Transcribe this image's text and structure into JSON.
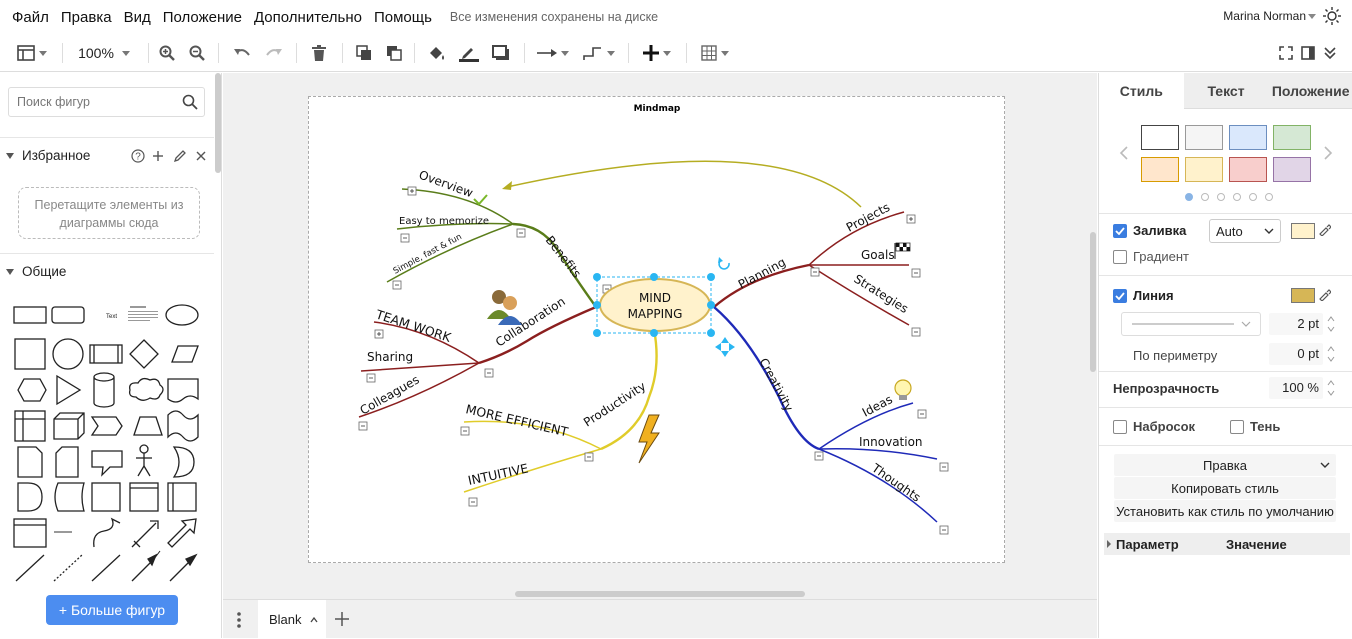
{
  "menu": {
    "items": [
      "Файл",
      "Правка",
      "Вид",
      "Положение",
      "Дополнительно",
      "Помощь"
    ],
    "status": "Все изменения сохранены на диске",
    "user": "Marina Norman"
  },
  "toolbar": {
    "zoom": "100%"
  },
  "left": {
    "search_placeholder": "Поиск фигур",
    "favorites_title": "Избранное",
    "dropzone_text": "Перетащите элементы из диаграммы сюда",
    "general_title": "Общие",
    "more_shapes": "+ Больше фигур"
  },
  "diagram": {
    "title": "Mindmap",
    "center_line1": "MIND",
    "center_line2": "MAPPING",
    "branches": {
      "benefits": "Benefits",
      "overview": "Overview",
      "easy": "Easy to memorize",
      "simple": "Simple, fast & fun",
      "collaboration": "Collaboration",
      "teamwork": "TEAM WORK",
      "sharing": "Sharing",
      "colleagues": "Colleagues",
      "productivity": "Productivity",
      "efficient": "MORE EFFICIENT",
      "intuitive": "INTUITIVE",
      "planning": "Planning",
      "projects": "Projects",
      "goals": "Goals",
      "strategies": "Strategies",
      "creativity": "Creativity",
      "ideas": "Ideas",
      "innovation": "Innovation",
      "thoughts": "Thoughts"
    }
  },
  "bottom": {
    "page_tab": "Blank"
  },
  "right": {
    "tabs": [
      "Стиль",
      "Текст",
      "Положение"
    ],
    "swatches": [
      "#ffffff",
      "#f5f5f5",
      "#dae8fc",
      "#d5e8d4",
      "#ffe6cc",
      "#fff2cc",
      "#f8cecc",
      "#e1d5e7"
    ],
    "fill_label": "Заливка",
    "fill_value": "Auto",
    "fill_color": "#fff2cc",
    "gradient_label": "Градиент",
    "line_label": "Линия",
    "line_color": "#d6b656",
    "line_width": "2 pt",
    "perimeter_label": "По периметру",
    "perimeter_value": "0 pt",
    "opacity_label": "Непрозрачность",
    "opacity_value": "100 %",
    "sketch_label": "Набросок",
    "shadow_label": "Тень",
    "edit_label": "Правка",
    "copy_style": "Копировать стиль",
    "set_default": "Установить как стиль по умолчанию",
    "param_label": "Параметр",
    "value_label": "Значение"
  }
}
